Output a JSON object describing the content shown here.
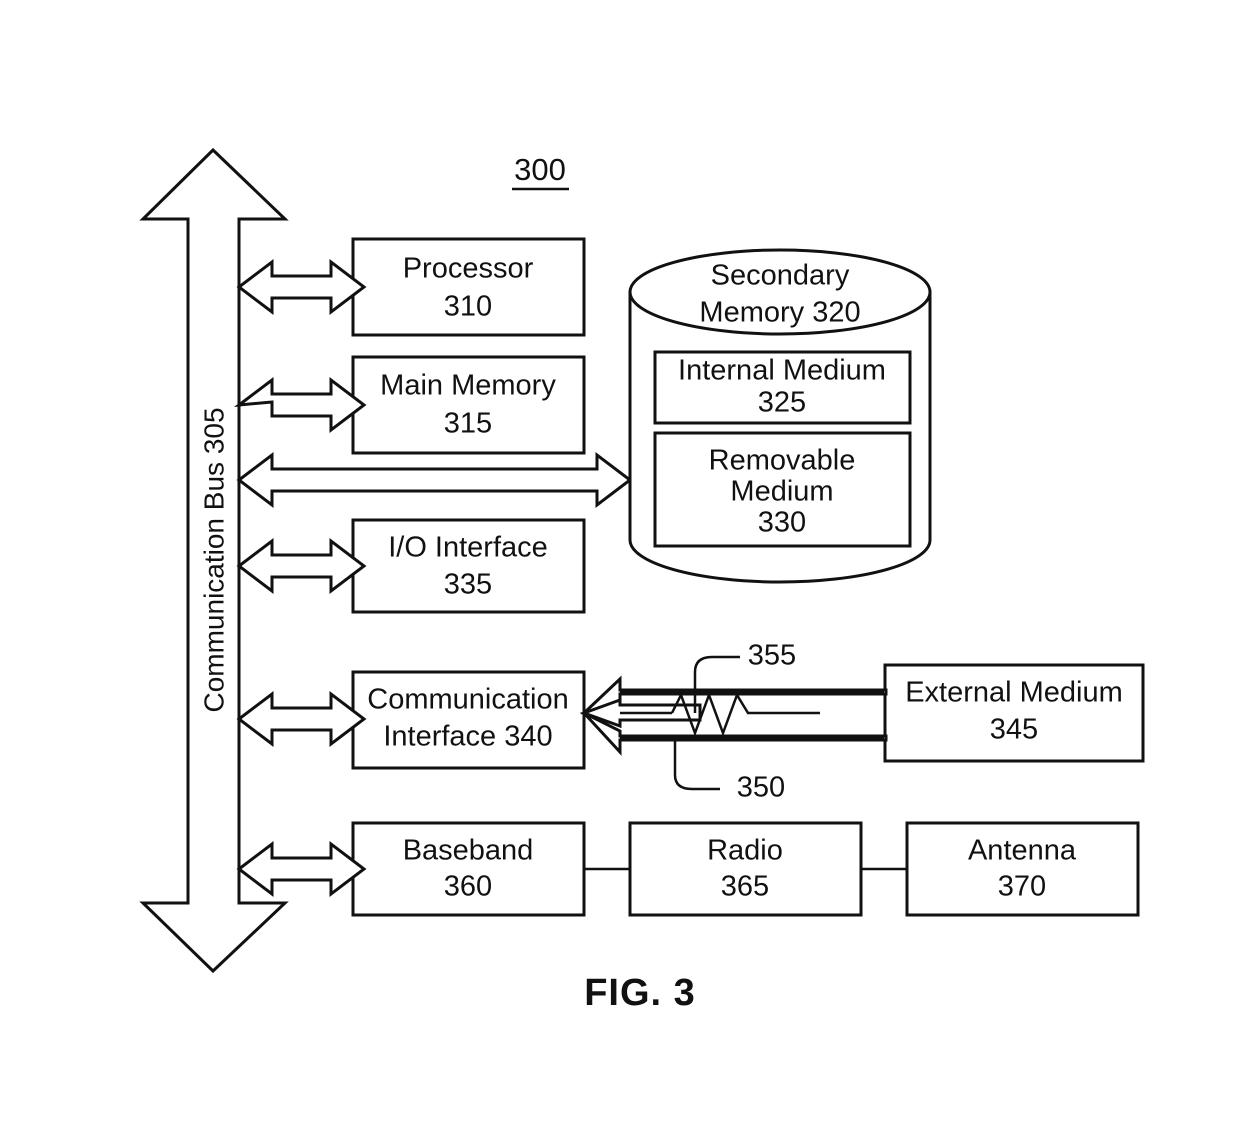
{
  "figure": {
    "caption": "FIG. 3",
    "system_number": "300"
  },
  "bus": {
    "label": "Communication Bus 305",
    "reference": "305",
    "name": "Communication Bus",
    "orientation": "vertical",
    "arrow_type": "double-headed hollow"
  },
  "blocks": [
    {
      "id": "processor",
      "title": "Processor",
      "reference": "310"
    },
    {
      "id": "main_memory",
      "title": "Main Memory",
      "reference": "315"
    },
    {
      "id": "io_interface",
      "title": "I/O Interface",
      "reference": "335"
    },
    {
      "id": "comm_interface_line1",
      "title": "Communication",
      "reference": "Interface 340"
    },
    {
      "id": "baseband",
      "title": "Baseband",
      "reference": "360"
    },
    {
      "id": "radio",
      "title": "Radio",
      "reference": "365"
    },
    {
      "id": "antenna",
      "title": "Antenna",
      "reference": "370"
    },
    {
      "id": "external_medium",
      "title": "External Medium",
      "reference": "345"
    }
  ],
  "secondary_memory": {
    "title_line1": "Secondary",
    "title_line2": "Memory 320",
    "reference": "320",
    "shape": "cylinder",
    "children": [
      {
        "id": "internal_medium",
        "title_line1": "Internal Medium",
        "title_line2": "",
        "reference": "325"
      },
      {
        "id": "removable_medium",
        "title_line1": "Removable",
        "title_line2": "Medium",
        "reference": "330"
      }
    ]
  },
  "connector_labels": [
    {
      "id": "label_355",
      "text": "355",
      "describes": "wireless/zigzag link between External Medium and Communication Interface"
    },
    {
      "id": "label_350",
      "text": "350",
      "describes": "wired link between External Medium and Communication Interface"
    }
  ],
  "colors": {
    "stroke": "#111111",
    "background": "#ffffff",
    "fill": "#ffffff"
  }
}
